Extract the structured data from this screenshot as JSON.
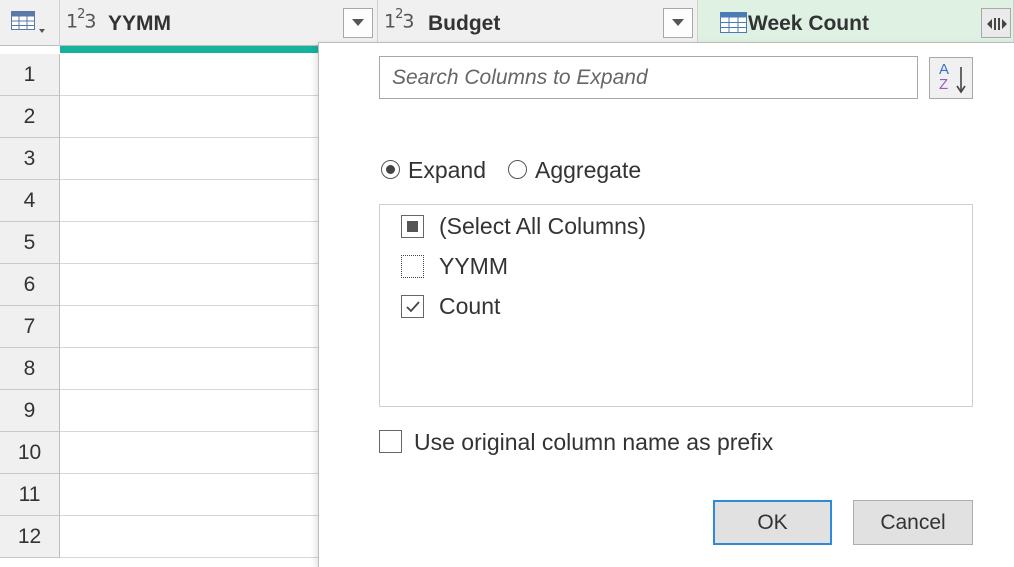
{
  "grid": {
    "columns": [
      {
        "type_icon": "1²3",
        "name": "YYMM"
      },
      {
        "type_icon": "1²3",
        "name": "Budget"
      },
      {
        "type_icon": "table-icon",
        "name": "Week Count"
      }
    ],
    "row_numbers": [
      "1",
      "2",
      "3",
      "4",
      "5",
      "6",
      "7",
      "8",
      "9",
      "10",
      "11",
      "12"
    ]
  },
  "popup": {
    "search_placeholder": "Search Columns to Expand",
    "sort_icon": "sort-a-z-icon",
    "mode_options": [
      {
        "label": "Expand",
        "selected": true
      },
      {
        "label": "Aggregate",
        "selected": false
      }
    ],
    "column_items": [
      {
        "label": "(Select All Columns)",
        "state": "partial"
      },
      {
        "label": "YYMM",
        "state": "unchecked"
      },
      {
        "label": "Count",
        "state": "checked"
      }
    ],
    "prefix_label": "Use original column name as prefix",
    "prefix_checked": false,
    "ok_label": "OK",
    "cancel_label": "Cancel"
  },
  "colors": {
    "accent": "#2e8ad8",
    "quality_bar": "#15b39e",
    "table_column_header": "#def1e3"
  }
}
